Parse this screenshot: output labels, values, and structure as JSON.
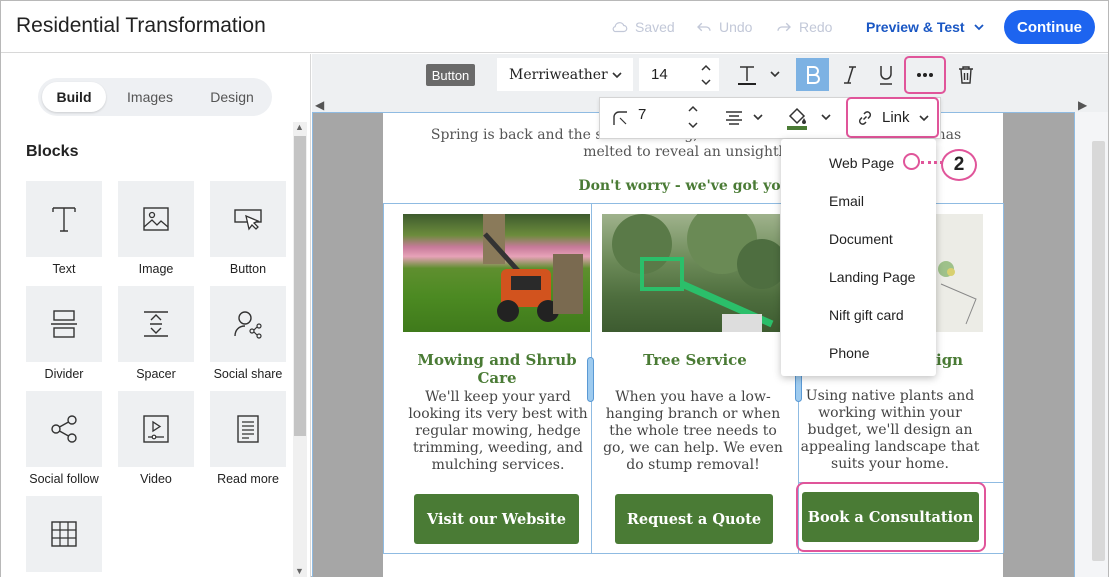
{
  "app": {
    "title": "Residential Transformation",
    "saved": "Saved",
    "undo": "Undo",
    "redo": "Redo",
    "preview": "Preview & Test",
    "continue": "Continue"
  },
  "sidebar": {
    "tabs": [
      "Build",
      "Images",
      "Design"
    ],
    "active_tab": "Build",
    "blocks_heading": "Blocks",
    "blocks": [
      {
        "label": "Text",
        "icon": "text-icon"
      },
      {
        "label": "Image",
        "icon": "image-icon"
      },
      {
        "label": "Button",
        "icon": "button-icon"
      },
      {
        "label": "Divider",
        "icon": "divider-icon"
      },
      {
        "label": "Spacer",
        "icon": "spacer-icon"
      },
      {
        "label": "Social share",
        "icon": "social-share-icon"
      },
      {
        "label": "Social follow",
        "icon": "social-follow-icon"
      },
      {
        "label": "Video",
        "icon": "video-icon"
      },
      {
        "label": "Read more",
        "icon": "read-more-icon"
      },
      {
        "label": "",
        "icon": "table-icon"
      }
    ]
  },
  "toolbar": {
    "element_tag": "Button",
    "font_family": "Merriweather",
    "font_size": "14",
    "padding_value": "7",
    "link_label": "Link"
  },
  "link_menu": {
    "items": [
      "Web Page",
      "Email",
      "Document",
      "Landing Page",
      "Nift gift card",
      "Phone"
    ]
  },
  "callout": {
    "number": "2"
  },
  "email": {
    "intro_line1": "Spring is back and the sun is shining, the shrubs are out and the snow has",
    "intro_line2": "melted to reveal an unsightly m",
    "worry": "Don't worry - we've got you co",
    "services": [
      {
        "title": "Mowing and Shrub Care",
        "body": "We'll keep your yard looking its very best with regular mowing, hedge trimming, weeding, and mulching services.",
        "cta": "Visit our Website"
      },
      {
        "title": "Tree Service",
        "body": "When you have a low-hanging branch or when the whole tree needs to go, we can help. We even do stump removal!",
        "cta": "Request a Quote"
      },
      {
        "title": "ign",
        "body": "Using native plants and working within your budget, we'll design an appealing landscape that suits your home.",
        "cta": "Book a Consultation"
      }
    ]
  },
  "colors": {
    "accent_blue": "#1d64ef",
    "brand_green": "#4a7b35",
    "highlight_pink": "#e0559a"
  }
}
